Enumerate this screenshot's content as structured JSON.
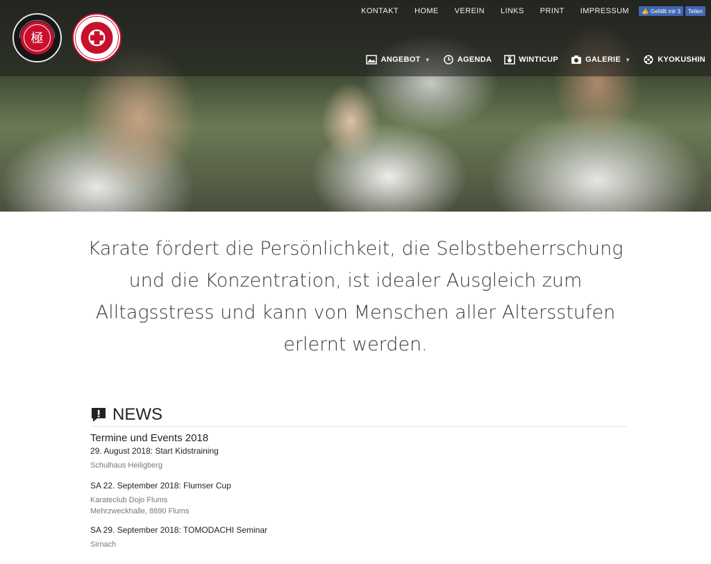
{
  "top_nav": {
    "items": [
      "KONTAKT",
      "HOME",
      "VEREIN",
      "LINKS",
      "PRINT",
      "IMPRESSUM"
    ],
    "fb_like": "Gefällt mir 3",
    "fb_share": "Teilen"
  },
  "main_nav": {
    "items": [
      {
        "label": "ANGEBOT",
        "icon": "photo-icon",
        "dropdown": true
      },
      {
        "label": "AGENDA",
        "icon": "clock-icon",
        "dropdown": false
      },
      {
        "label": "WINTICUP",
        "icon": "medal-icon",
        "dropdown": false
      },
      {
        "label": "GALERIE",
        "icon": "camera-icon",
        "dropdown": true
      },
      {
        "label": "KYOKUSHIN",
        "icon": "kyokushin-emblem-icon",
        "dropdown": false
      }
    ]
  },
  "logos": {
    "left": "KYOKUSHINKAI KARATE WINTERTHUR",
    "right": "KYOKUSHIN KARATE UNION SWISS"
  },
  "hero": {
    "image": "karate-training-group-photo"
  },
  "quote": "Karate fördert die Persönlichkeit, die Selbstbeherrschung und die Konzentration, ist idealer Ausgleich zum Alltagsstress und kann von Menschen aller Altersstufen erlernt werden.",
  "news": {
    "heading": "NEWS",
    "subtitle": "Termine und Events 2018",
    "events": [
      {
        "title": "29. August 2018: Start Kidstraining",
        "location": [
          "Schulhaus Heiligberg"
        ]
      },
      {
        "title": "SA 22. September 2018: Flumser Cup",
        "location": [
          "Karateclub Dojo Flums",
          "Mehrzweckhalle, 8890 Flums"
        ]
      },
      {
        "title": "SA 29. September 2018: TOMODACHI Seminar",
        "location": [
          "Sirnach"
        ]
      }
    ]
  },
  "colors": {
    "brand_red": "#c8102e",
    "fb_blue": "#4267b2",
    "text_dark": "#222222"
  }
}
